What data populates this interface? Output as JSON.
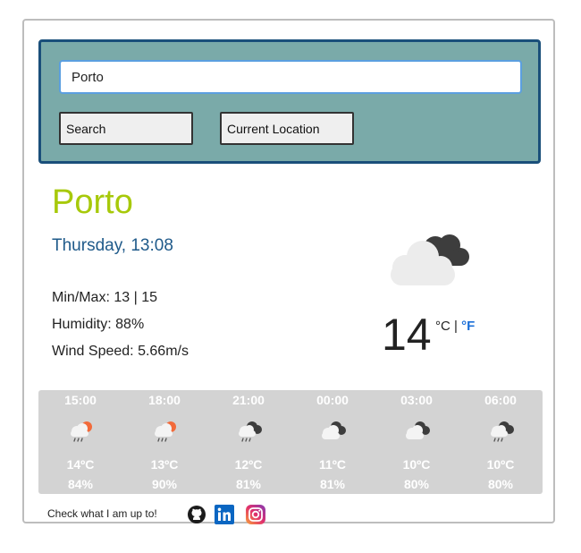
{
  "search": {
    "value": "Porto",
    "search_label": "Search",
    "location_label": "Current Location"
  },
  "current": {
    "city": "Porto",
    "date": "Thursday, 13:08",
    "minmax_label": "Min/Max:",
    "minmax_value": "13 | 15",
    "humidity_label": "Humidity:",
    "humidity_value": "88%",
    "wind_label": "Wind Speed:",
    "wind_value": "5.66m/s",
    "temperature": "14",
    "unit_c": "°C",
    "unit_sep": "|",
    "unit_f": "°F",
    "icon": "broken-clouds-icon"
  },
  "forecast": [
    {
      "time": "15:00",
      "temp": "14ºC",
      "humidity": "84%",
      "icon": "light-rain-sun-icon"
    },
    {
      "time": "18:00",
      "temp": "13ºC",
      "humidity": "90%",
      "icon": "light-rain-sun-icon"
    },
    {
      "time": "21:00",
      "temp": "12ºC",
      "humidity": "81%",
      "icon": "rain-cloud-icon"
    },
    {
      "time": "00:00",
      "temp": "11ºC",
      "humidity": "81%",
      "icon": "broken-clouds-icon"
    },
    {
      "time": "03:00",
      "temp": "10ºC",
      "humidity": "80%",
      "icon": "broken-clouds-icon"
    },
    {
      "time": "06:00",
      "temp": "10ºC",
      "humidity": "80%",
      "icon": "rain-cloud-icon"
    }
  ],
  "footer": {
    "text": "Check what I am up to!",
    "links": [
      "github-icon",
      "linkedin-icon",
      "instagram-icon"
    ]
  },
  "colors": {
    "panel": "#7aaaa9",
    "panel_border": "#1a4f7a",
    "city": "#a7c90a",
    "date": "#1f5a8a",
    "link": "#1b6fd8",
    "forecast_bg": "#d3d3d3"
  }
}
